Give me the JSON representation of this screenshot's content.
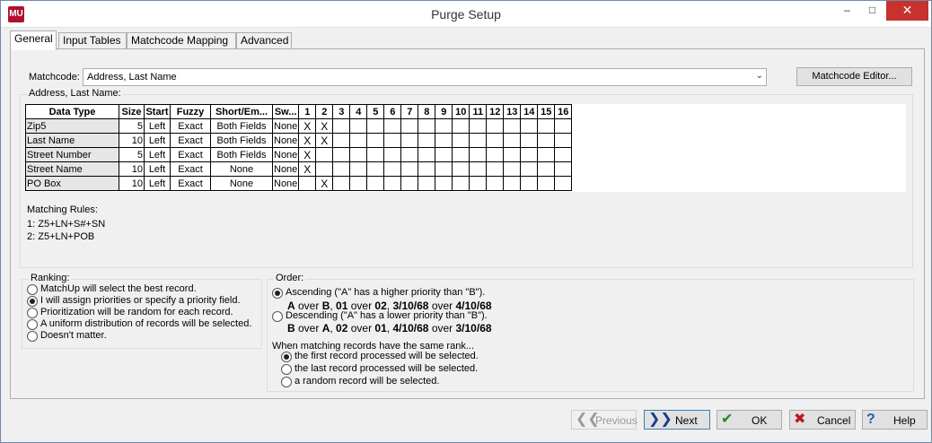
{
  "window": {
    "title": "Purge Setup",
    "app_icon_text": "MU",
    "controls": {
      "minimize": "–",
      "maximize": "□",
      "close": "✕"
    }
  },
  "tabs": [
    "General",
    "Input Tables",
    "Matchcode Mapping",
    "Advanced"
  ],
  "matchcode": {
    "label": "Matchcode:",
    "value": "Address, Last Name",
    "editor_button": "Matchcode Editor..."
  },
  "grid": {
    "caption": "Address, Last Name:",
    "headers": [
      "Data Type",
      "Size",
      "Start",
      "Fuzzy",
      "Short/Em...",
      "Sw...",
      "1",
      "2",
      "3",
      "4",
      "5",
      "6",
      "7",
      "8",
      "9",
      "10",
      "11",
      "12",
      "13",
      "14",
      "15",
      "16"
    ],
    "rows": [
      {
        "type": "Zip5",
        "size": "5",
        "start": "Left",
        "fuzzy": "Exact",
        "short": "Both Fields",
        "sw": "None",
        "marks": [
          "X",
          "X",
          "",
          "",
          "",
          "",
          "",
          "",
          "",
          "",
          "",
          "",
          "",
          "",
          "",
          ""
        ]
      },
      {
        "type": "Last Name",
        "size": "10",
        "start": "Left",
        "fuzzy": "Exact",
        "short": "Both Fields",
        "sw": "None",
        "marks": [
          "X",
          "X",
          "",
          "",
          "",
          "",
          "",
          "",
          "",
          "",
          "",
          "",
          "",
          "",
          "",
          ""
        ]
      },
      {
        "type": "Street Number",
        "size": "5",
        "start": "Left",
        "fuzzy": "Exact",
        "short": "Both Fields",
        "sw": "None",
        "marks": [
          "X",
          "",
          "",
          "",
          "",
          "",
          "",
          "",
          "",
          "",
          "",
          "",
          "",
          "",
          "",
          ""
        ]
      },
      {
        "type": "Street Name",
        "size": "10",
        "start": "Left",
        "fuzzy": "Exact",
        "short": "None",
        "sw": "None",
        "marks": [
          "X",
          "",
          "",
          "",
          "",
          "",
          "",
          "",
          "",
          "",
          "",
          "",
          "",
          "",
          "",
          ""
        ]
      },
      {
        "type": "PO Box",
        "size": "10",
        "start": "Left",
        "fuzzy": "Exact",
        "short": "None",
        "sw": "None",
        "marks": [
          "",
          "X",
          "",
          "",
          "",
          "",
          "",
          "",
          "",
          "",
          "",
          "",
          "",
          "",
          "",
          ""
        ]
      }
    ],
    "rules_label": "Matching Rules:",
    "rules": [
      "1: Z5+LN+S#+SN",
      "2: Z5+LN+POB"
    ]
  },
  "ranking": {
    "caption": "Ranking:",
    "selected": 1,
    "options": [
      "MatchUp will select the best record.",
      "I will assign priorities or specify a priority field.",
      "Prioritization will be random for each record.",
      "A uniform distribution of records will be selected.",
      "Doesn't matter."
    ]
  },
  "order": {
    "caption": "Order:",
    "selected": 0,
    "ascending": {
      "label": "Ascending (\"A\" has a higher priority than \"B\").",
      "parts": [
        "A",
        " over ",
        "B",
        ", ",
        "01",
        " over ",
        "02",
        ", ",
        "3/10/68",
        " over ",
        "4/10/68"
      ]
    },
    "descending": {
      "label": "Descending (\"A\" has a lower priority than \"B\").",
      "parts": [
        "B",
        " over ",
        "A",
        ", ",
        "02",
        " over ",
        "01",
        ", ",
        "4/10/68",
        " over ",
        "3/10/68"
      ]
    },
    "same_rank_label": "When matching records have the same rank...",
    "same_rank_selected": 0,
    "same_rank_options": [
      "the first record processed will be selected.",
      "the last record processed will be selected.",
      "a random record will be selected."
    ]
  },
  "buttons": {
    "previous": "Previous",
    "next": "Next",
    "ok": "OK",
    "cancel": "Cancel",
    "help": "Help"
  }
}
